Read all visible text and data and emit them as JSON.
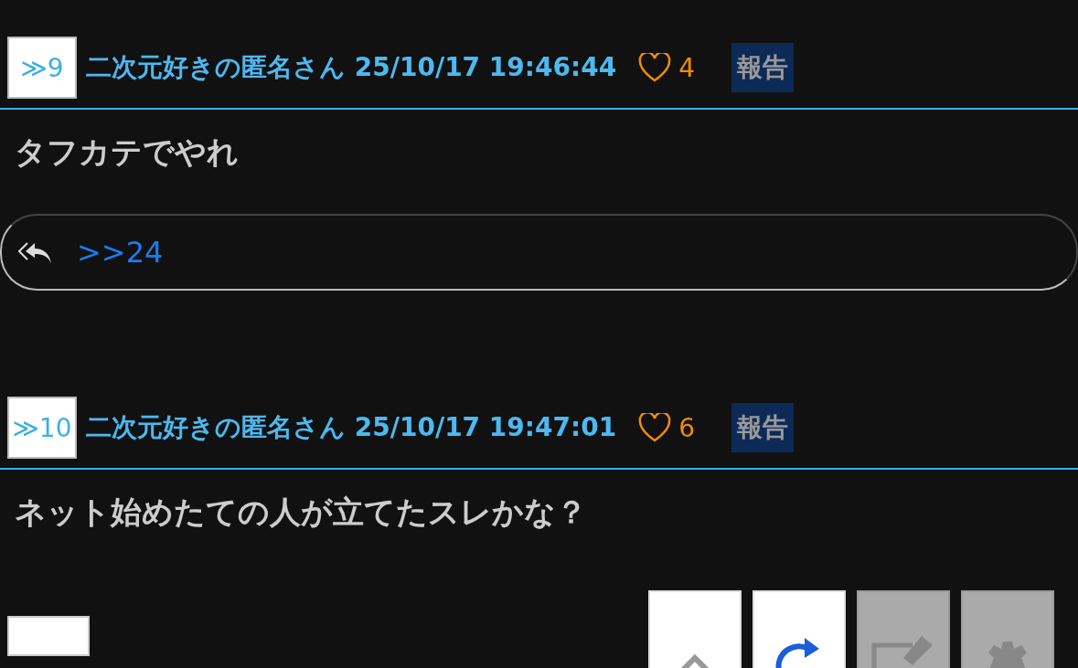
{
  "posts": [
    {
      "number": "≫9",
      "author": "二次元好きの匿名さん",
      "timestamp": "25/10/17 19:46:44",
      "likes": "4",
      "report": "報告",
      "body": "タフカテでやれ",
      "replies": [
        ">>24"
      ]
    },
    {
      "number": "≫10",
      "author": "二次元好きの匿名さん",
      "timestamp": "25/10/17 19:47:01",
      "likes": "6",
      "report": "報告",
      "body": "ネット始めたての人が立てたスレかな？"
    }
  ],
  "toolbar": [
    {
      "kind": "up",
      "disabled": false
    },
    {
      "kind": "refresh",
      "disabled": false
    },
    {
      "kind": "edit",
      "disabled": true
    },
    {
      "kind": "settings",
      "disabled": true
    }
  ]
}
